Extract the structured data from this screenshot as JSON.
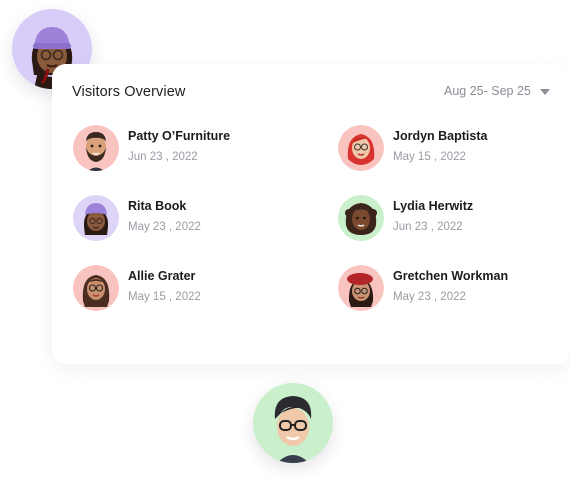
{
  "header": {
    "title": "Visitors Overview",
    "date_range": "Aug 25- Sep 25"
  },
  "visitors": [
    {
      "name": "Patty O’Furniture",
      "date": "Jun 23 , 2022",
      "bg": "#f9c3c0"
    },
    {
      "name": "Jordyn Baptista",
      "date": "May 15 , 2022",
      "bg": "#f9c3c0"
    },
    {
      "name": "Rita Book",
      "date": "May 23 , 2022",
      "bg": "#ddd4f7"
    },
    {
      "name": "Lydia Herwitz",
      "date": "Jun 23 , 2022",
      "bg": "#c9efcb"
    },
    {
      "name": "Allie Grater",
      "date": "May 15 , 2022",
      "bg": "#f9c3c0"
    },
    {
      "name": "Gretchen Workman",
      "date": "May 23 , 2022",
      "bg": "#f9c3c0"
    }
  ],
  "colors": {
    "pink": "#f9c3c0",
    "lavender": "#ddd4f7",
    "mint": "#c9efcb"
  }
}
